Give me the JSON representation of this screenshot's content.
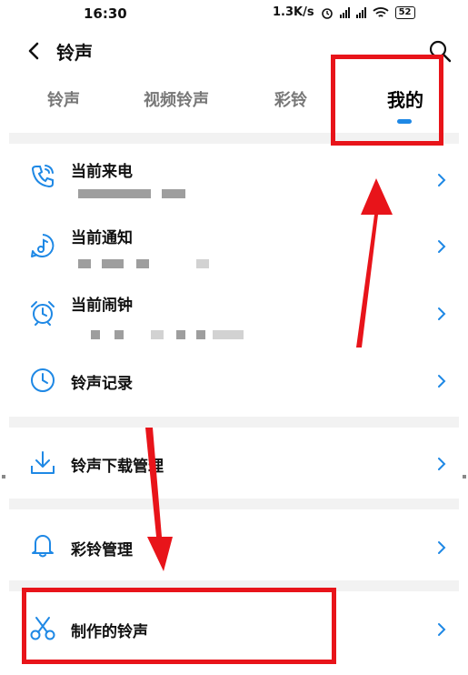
{
  "status_bar": {
    "time": "16:30",
    "net_speed": "1.3K/s",
    "signal_label": "HD",
    "battery": "52"
  },
  "header": {
    "title": "铃声"
  },
  "tabs": [
    {
      "label": "铃声",
      "active": false
    },
    {
      "label": "视频铃声",
      "active": false
    },
    {
      "label": "彩铃",
      "active": false
    },
    {
      "label": "我的",
      "active": true
    }
  ],
  "rows": [
    {
      "title": "当前来电",
      "icon": "phone-icon"
    },
    {
      "title": "当前通知",
      "icon": "music-note-icon"
    },
    {
      "title": "当前闹钟",
      "icon": "alarm-clock-icon"
    },
    {
      "title": "铃声记录",
      "icon": "clock-icon"
    },
    {
      "title": "铃声下载管理",
      "icon": "download-icon"
    },
    {
      "title": "彩铃管理",
      "icon": "bell-icon"
    },
    {
      "title": "制作的铃声",
      "icon": "scissors-icon"
    }
  ],
  "colors": {
    "accent": "#1e88e5",
    "highlight": "#e8141a"
  }
}
